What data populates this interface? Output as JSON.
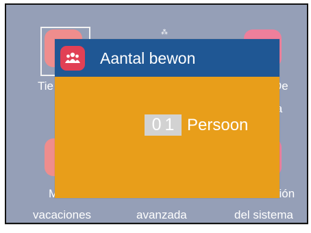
{
  "background_menu": {
    "items": [
      {
        "label": "Tie",
        "line2": ""
      },
      {
        "label": "De",
        "line2": "la"
      },
      {
        "label": "M",
        "line2": "vacaciones"
      },
      {
        "label": "",
        "line2": "avanzada"
      },
      {
        "label": "ción",
        "line2": "del sistema"
      }
    ],
    "tile_colors": {
      "salmon": "#ef8d8d",
      "pink": "#ee7f9b"
    },
    "background_color": "#959fb7"
  },
  "dialog": {
    "title": "Aantal bewon",
    "icon": "people-icon",
    "value": "01",
    "unit": "Persoon",
    "header_color": "#1f5794",
    "body_color": "#e89e1a",
    "icon_color": "#e14055"
  }
}
